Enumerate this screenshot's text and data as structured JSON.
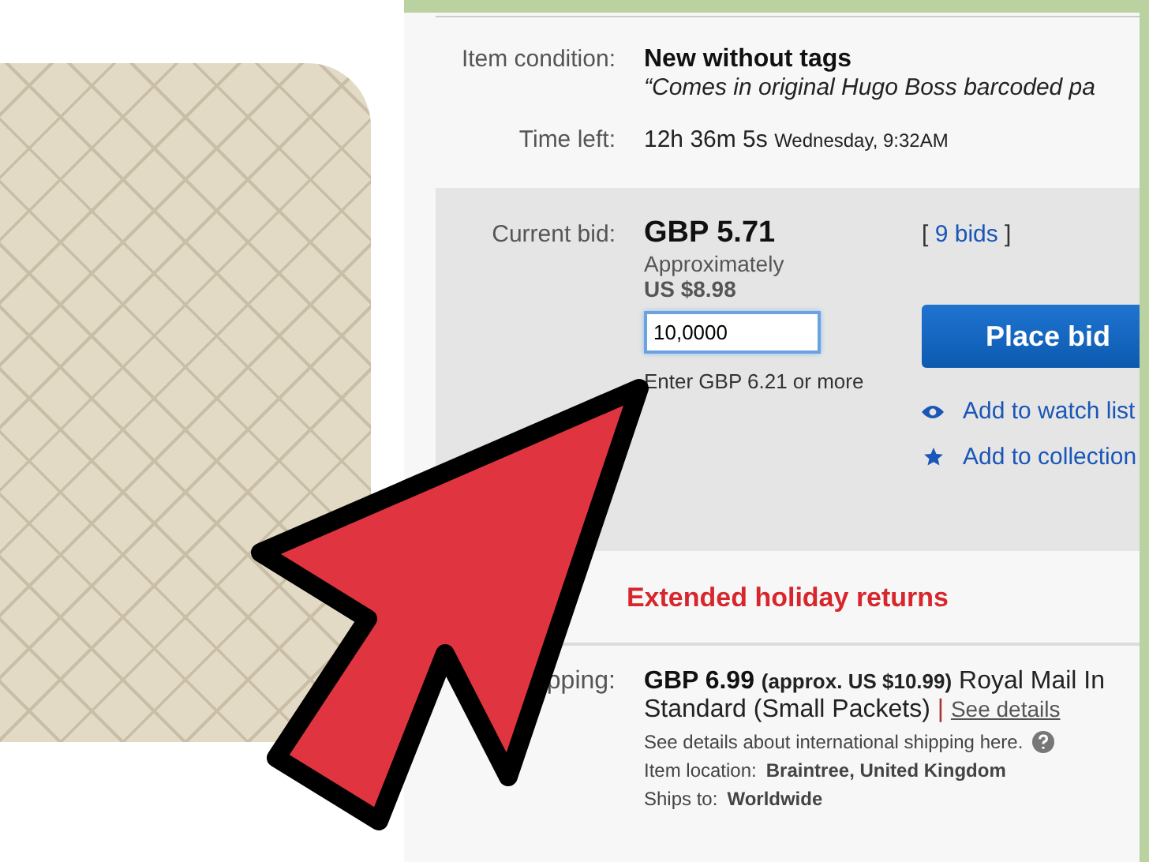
{
  "item_condition": {
    "label": "Item condition:",
    "value": "New without tags",
    "note": "“Comes in original Hugo Boss barcoded pa"
  },
  "time_left": {
    "label": "Time left:",
    "value": "12h 36m 5s",
    "end": "Wednesday, 9:32AM"
  },
  "bid": {
    "label": "Current bid:",
    "price": "GBP 5.71",
    "approx_label": "Approximately",
    "approx_value": "US $8.98",
    "bracket_open": "[",
    "bids_link": "9 bids",
    "bracket_close": "]",
    "input_value": "10,0000",
    "button": "Place bid",
    "hint": "Enter GBP 6.21 or more",
    "actions": [
      {
        "kind": "watch",
        "label": "Add to watch list"
      },
      {
        "kind": "collection",
        "label": "Add to collection"
      }
    ]
  },
  "returns": "Extended holiday returns",
  "shipping": {
    "label": "pping:",
    "price": "GBP 6.99",
    "approx": "(approx. US $10.99)",
    "service": "Royal Mail In",
    "service_line2": "Standard (Small Packets)",
    "separator": "|",
    "details_link": "See details",
    "intl_note": "See details about international shipping here.",
    "location_label": "Item location:",
    "location": "Braintree, United Kingdom",
    "ships_label": "Ships to:",
    "ships_to": "Worldwide"
  }
}
